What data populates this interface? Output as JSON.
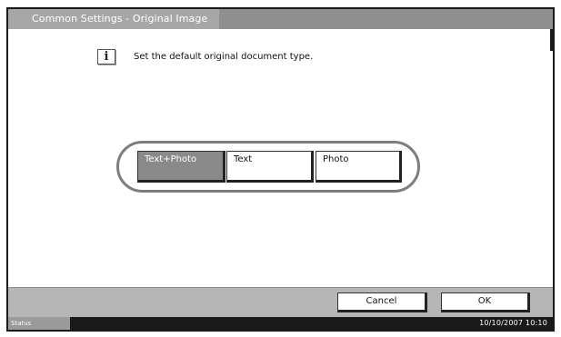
{
  "screen": {
    "title": "Common Settings - Original Image",
    "instruction": "Set the default original document type.",
    "info_icon": "info-icon"
  },
  "options": [
    {
      "label": "Text+Photo",
      "selected": true
    },
    {
      "label": "Text",
      "selected": false
    },
    {
      "label": "Photo",
      "selected": false
    }
  ],
  "buttons": {
    "cancel_label": "Cancel",
    "ok_label": "OK"
  },
  "status": {
    "label": "Status",
    "datetime": "10/10/2007   10:10"
  },
  "colors": {
    "title_bar": "#8f8f8f",
    "selected_option": "#8a8a8a",
    "bottom_bar": "#b6b6b6",
    "status_bar": "#1a1a1a"
  }
}
